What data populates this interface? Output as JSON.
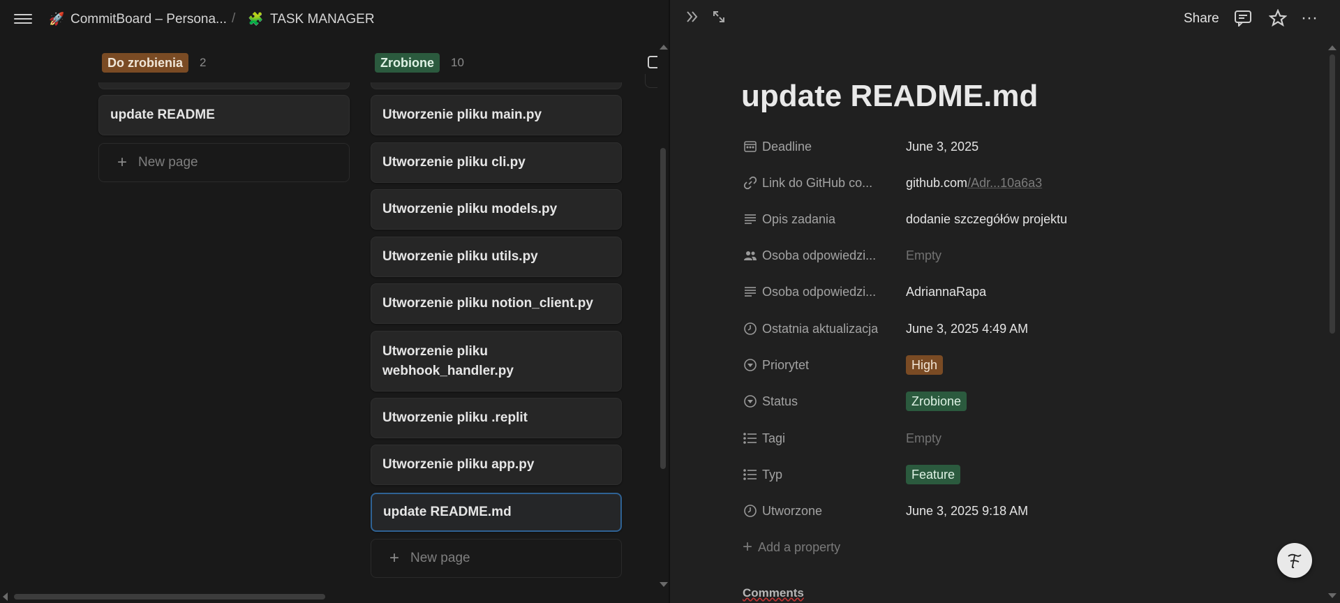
{
  "breadcrumb": {
    "workspace_label": "CommitBoard – Persona...",
    "separator": "/",
    "page_label": "TASK MANAGER"
  },
  "board": {
    "columns": [
      {
        "label": "Do zrobienia",
        "count": "2",
        "color": "#7a4b24",
        "cards": [
          "update README"
        ],
        "new_page_label": "New page"
      },
      {
        "label": "Zrobione",
        "count": "10",
        "color": "#2b5a3e",
        "cards": [
          "Utworzenie pliku main.py",
          "Utworzenie pliku cli.py",
          "Utworzenie pliku models.py",
          "Utworzenie pliku utils.py",
          "Utworzenie pliku notion_client.py",
          "Utworzenie pliku webhook_handler.py",
          "Utworzenie pliku .replit",
          "Utworzenie pliku app.py",
          "update README.md"
        ],
        "new_page_label": "New page"
      }
    ]
  },
  "peek": {
    "share_label": "Share",
    "title": "update README.md",
    "properties": [
      {
        "icon": "calendar-icon",
        "name": "Deadline",
        "value": "June 3, 2025"
      },
      {
        "icon": "link-icon",
        "name": "Link do GitHub co...",
        "value_main": "github.com",
        "value_dim": "/Adr...10a6a3"
      },
      {
        "icon": "text-icon",
        "name": "Opis zadania",
        "value": "dodanie szczegółów projektu"
      },
      {
        "icon": "people-icon",
        "name": "Osoba odpowiedzi...",
        "value": "Empty"
      },
      {
        "icon": "text-icon",
        "name": "Osoba odpowiedzi...",
        "value": "AdriannaRapa"
      },
      {
        "icon": "clock-icon",
        "name": "Ostatnia aktualizacja",
        "value": "June 3, 2025 4:49 AM"
      },
      {
        "icon": "select-icon",
        "name": "Priorytet",
        "value": "High"
      },
      {
        "icon": "select-icon",
        "name": "Status",
        "value": "Zrobione"
      },
      {
        "icon": "list-icon",
        "name": "Tagi",
        "value": "Empty"
      },
      {
        "icon": "list-icon",
        "name": "Typ",
        "value": "Feature"
      },
      {
        "icon": "clock-icon",
        "name": "Utworzone",
        "value": "June 3, 2025 9:18 AM"
      }
    ],
    "add_property_label": "Add a property",
    "comments_label": "Comments"
  },
  "colors": {
    "tag_brown": "#7a4b24",
    "tag_green": "#2b5a3e",
    "selected_border": "#2f6294"
  }
}
